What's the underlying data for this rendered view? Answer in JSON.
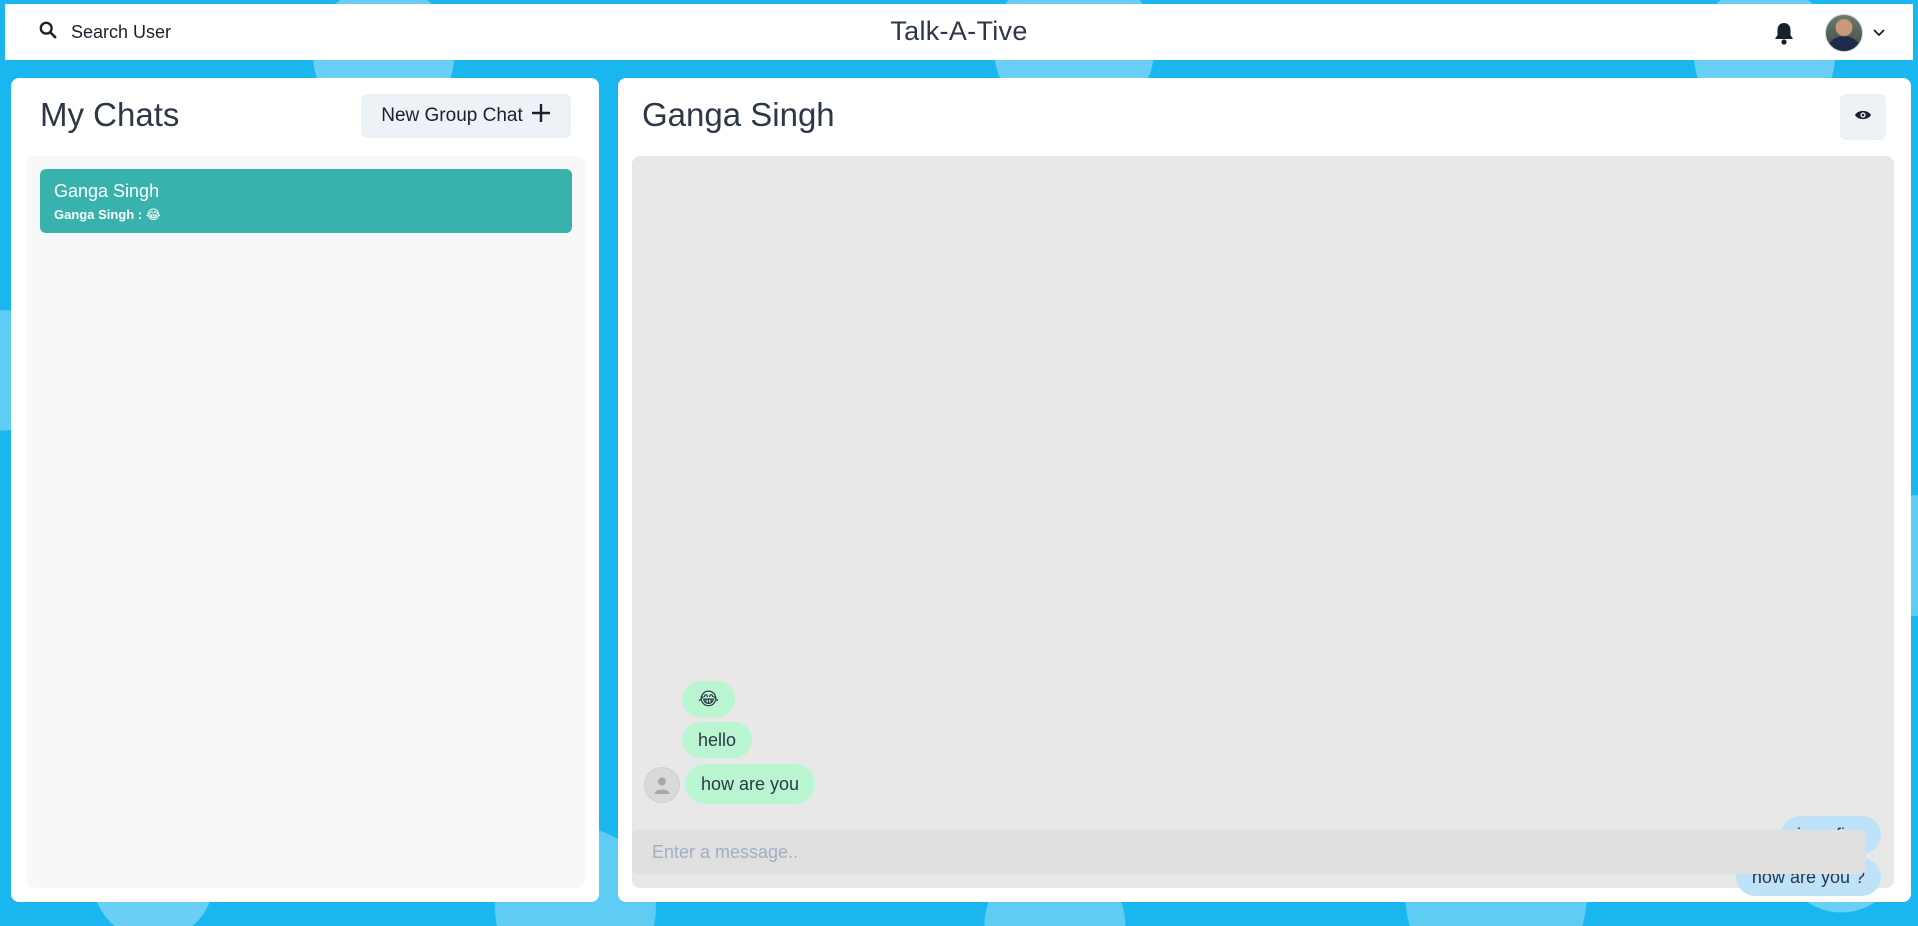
{
  "header": {
    "search_label": "Search User",
    "app_title": "Talk-A-Tive",
    "icons": {
      "search": "search-icon",
      "bell": "bell-icon",
      "avatar": "avatar",
      "chevron": "chevron-down-icon"
    }
  },
  "sidebar": {
    "title": "My Chats",
    "new_group_label": "New Group Chat",
    "chats": [
      {
        "name": "Ganga Singh",
        "latest_message": "Ganga Singh : 😂",
        "selected": true
      }
    ]
  },
  "chat": {
    "title": "Ganga Singh",
    "messages": [
      {
        "text": "😂",
        "from": "other"
      },
      {
        "text": "hello",
        "from": "other"
      },
      {
        "text": "how are you",
        "from": "other"
      },
      {
        "text": "i am fine",
        "from": "me"
      },
      {
        "text": "how are you ?",
        "from": "me"
      }
    ],
    "input_placeholder": "Enter a message.."
  },
  "colors": {
    "background": "#1ab6ef",
    "selected_chat": "#38b2ac",
    "other_bubble": "#b9f5d0",
    "my_bubble": "#bee3f8"
  }
}
